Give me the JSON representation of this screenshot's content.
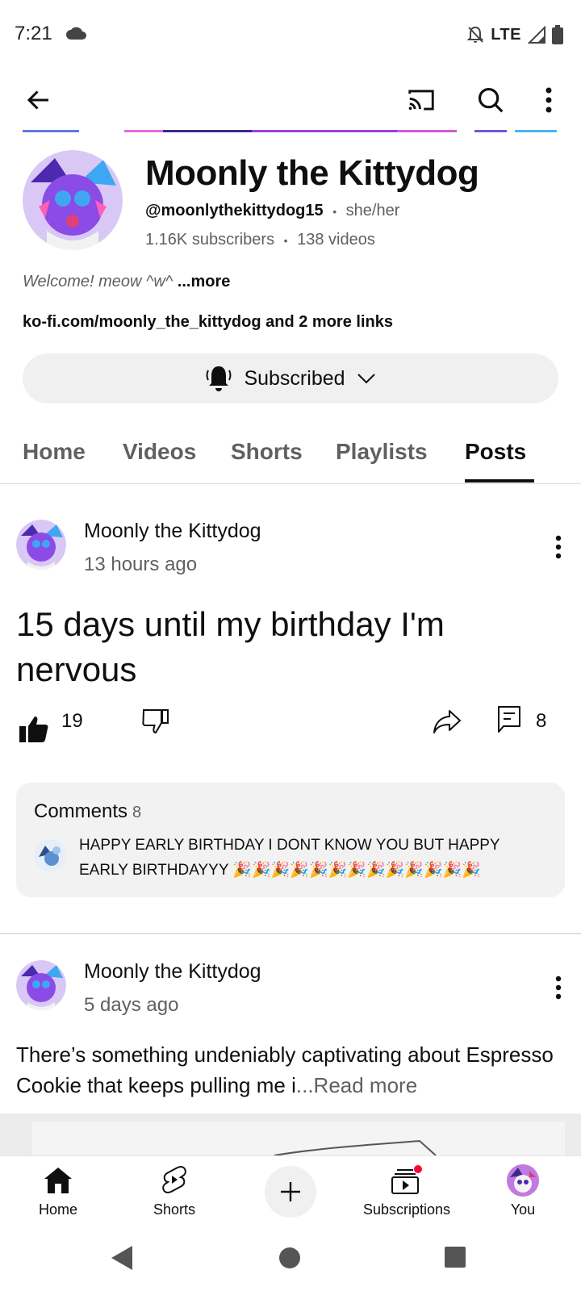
{
  "status_bar": {
    "time": "7:21",
    "network": "LTE",
    "icons": [
      "cloud-icon",
      "bell-off-icon",
      "signal-icon",
      "battery-icon"
    ]
  },
  "app_bar": {
    "icons": [
      "back-arrow-icon",
      "cast-icon",
      "search-icon",
      "more-vert-icon"
    ]
  },
  "channel": {
    "name": "Moonly the Kittydog",
    "handle": "@moonlythekittydog15",
    "pronouns": "she/her",
    "subscribers": "1.16K subscribers",
    "videos": "138 videos",
    "separator": "•",
    "description": "Welcome! meow ^w^",
    "description_more": "...more",
    "links": "ko-fi.com/moonly_the_kittydog and 2 more links",
    "subscribe_label": "Subscribed"
  },
  "tabs": [
    {
      "label": "Home",
      "active": false
    },
    {
      "label": "Videos",
      "active": false
    },
    {
      "label": "Shorts",
      "active": false
    },
    {
      "label": "Playlists",
      "active": false
    },
    {
      "label": "Posts",
      "active": true
    }
  ],
  "posts": [
    {
      "author": "Moonly the Kittydog",
      "time": "13 hours ago",
      "text": "15 days until my birthday I'm nervous",
      "likes": "19",
      "comments_count": "8",
      "comments_label": "Comments",
      "top_comment": "HAPPY EARLY BIRTHDAY I DONT KNOW YOU BUT HAPPY EARLY BIRTHDAYYY 🎉🎉🎉🎉🎉🎉🎉🎉🎉🎉🎉🎉🎉"
    },
    {
      "author": "Moonly the Kittydog",
      "time": "5 days ago",
      "text": "There’s something undeniably captivating about Espresso Cookie that keeps pulling me i",
      "read_more": "...Read more"
    }
  ],
  "bottom_nav": [
    {
      "label": "Home",
      "icon": "home-icon"
    },
    {
      "label": "Shorts",
      "icon": "shorts-icon"
    },
    {
      "label": "",
      "icon": "plus-icon"
    },
    {
      "label": "Subscriptions",
      "icon": "subscriptions-icon"
    },
    {
      "label": "You",
      "icon": "avatar"
    }
  ],
  "colors": {
    "primary_text": "#0f0f0f",
    "secondary_text": "#606060",
    "chip_bg": "#f0f0f0",
    "notification_dot": "#ff0033"
  }
}
